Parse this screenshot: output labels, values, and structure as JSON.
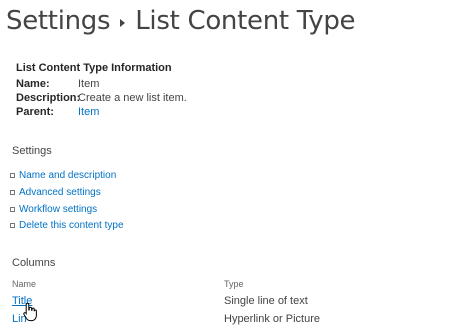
{
  "breadcrumb": {
    "root": "Settings",
    "current": "List Content Type"
  },
  "info": {
    "heading": "List Content Type Information",
    "name_label": "Name:",
    "name_value": "Item",
    "description_label": "Description:",
    "description_value": "Create a new list item.",
    "parent_label": "Parent:",
    "parent_value": "Item"
  },
  "settings": {
    "heading": "Settings",
    "links": [
      "Name and description",
      "Advanced settings",
      "Workflow settings",
      "Delete this content type"
    ]
  },
  "columns": {
    "heading": "Columns",
    "headers": [
      "Name",
      "Type"
    ],
    "rows": [
      {
        "name": "Title",
        "type": "Single line of text"
      },
      {
        "name": "Lin",
        "type": "Hyperlink or Picture"
      }
    ]
  },
  "colors": {
    "link": "#0072c6",
    "text": "#444444",
    "heading": "#262626"
  },
  "icons": [
    "breadcrumb-separator-icon",
    "bullet-icon",
    "hand-cursor-icon"
  ]
}
